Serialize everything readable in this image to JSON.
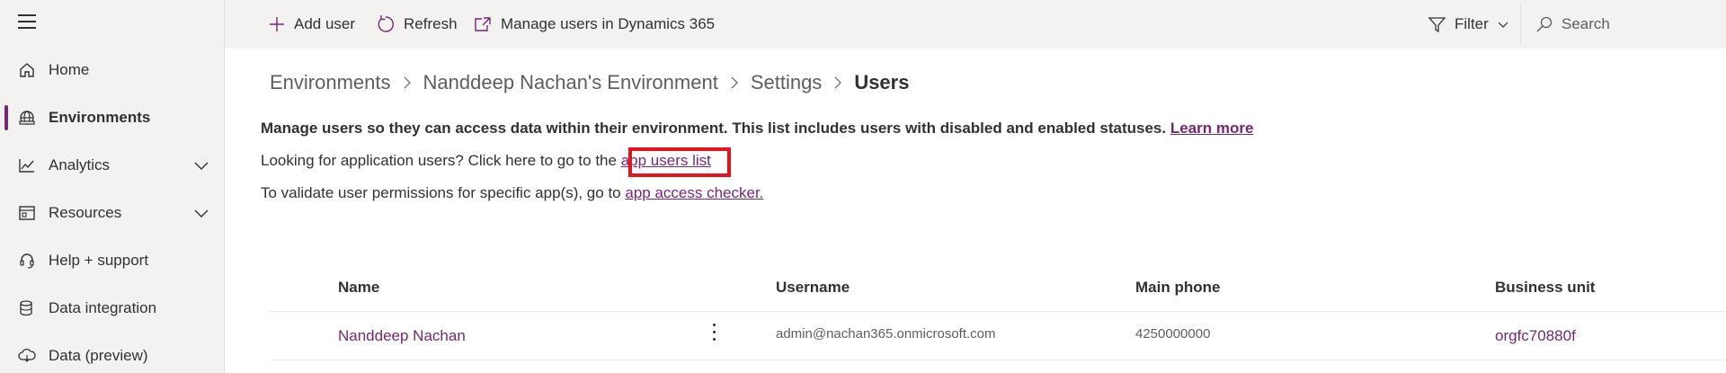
{
  "nav": {
    "items": [
      {
        "label": "Home",
        "icon": "home-icon"
      },
      {
        "label": "Environments",
        "icon": "environments-icon",
        "active": true
      },
      {
        "label": "Analytics",
        "icon": "analytics-icon",
        "expandable": true
      },
      {
        "label": "Resources",
        "icon": "resources-icon",
        "expandable": true
      },
      {
        "label": "Help + support",
        "icon": "headset-icon"
      },
      {
        "label": "Data integration",
        "icon": "database-icon"
      },
      {
        "label": "Data (preview)",
        "icon": "cloud-data-icon"
      }
    ]
  },
  "toolbar": {
    "add_user": "Add user",
    "refresh": "Refresh",
    "manage_dynamics": "Manage users in Dynamics 365",
    "filter": "Filter",
    "search_placeholder": "Search"
  },
  "breadcrumb": {
    "items": [
      "Environments",
      "Nanddeep Nachan's Environment",
      "Settings",
      "Users"
    ]
  },
  "info": {
    "description": "Manage users so they can access data within their environment. This list includes users with disabled and enabled statuses.",
    "learn_more": "Learn more",
    "app_users_prefix": "Looking for application users? Click here to go to the",
    "app_users_link": "app users list",
    "validate_prefix": "To validate user permissions for specific app(s), go to",
    "app_access_link": "app access checker."
  },
  "table": {
    "columns": [
      "Name",
      "Username",
      "Main phone",
      "Business unit"
    ],
    "rows": [
      {
        "name": "Nanddeep Nachan",
        "username": "admin@nachan365.onmicrosoft.com",
        "phone": "4250000000",
        "business_unit": "orgfc70880f"
      }
    ]
  },
  "colors": {
    "accent": "#742774",
    "highlight": "#e3141e",
    "chrome": "#f3f2f1"
  }
}
